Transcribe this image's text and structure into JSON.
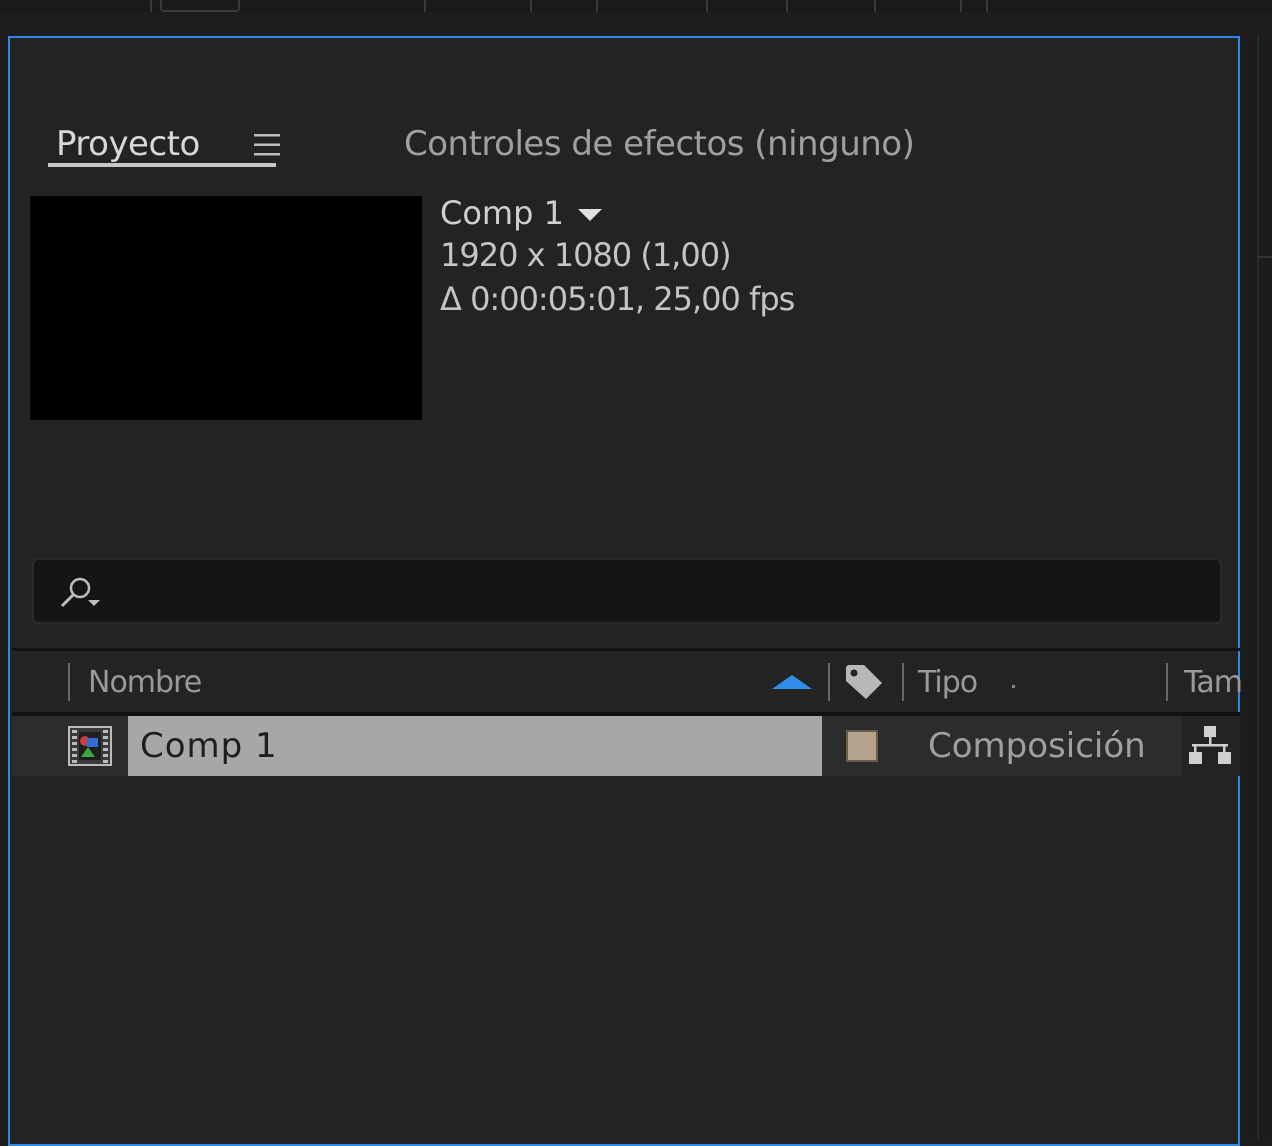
{
  "tabs": {
    "project_label": "Proyecto",
    "effects_label": "Controles de efectos (ninguno)"
  },
  "composition": {
    "name": "Comp 1",
    "resolution": "1920 x 1080 (1,00)",
    "duration": "Δ 0:00:05:01, 25,00 fps"
  },
  "search": {
    "value": ""
  },
  "columns": {
    "name": "Nombre",
    "type": "Tipo",
    "size": "Tam"
  },
  "items": [
    {
      "name": "Comp 1",
      "label_color": "#b5a48c",
      "type": "Composición"
    }
  ],
  "colors": {
    "accent": "#2e8ae6",
    "panel_bg": "#232323",
    "selection": "#a7a7a7"
  }
}
